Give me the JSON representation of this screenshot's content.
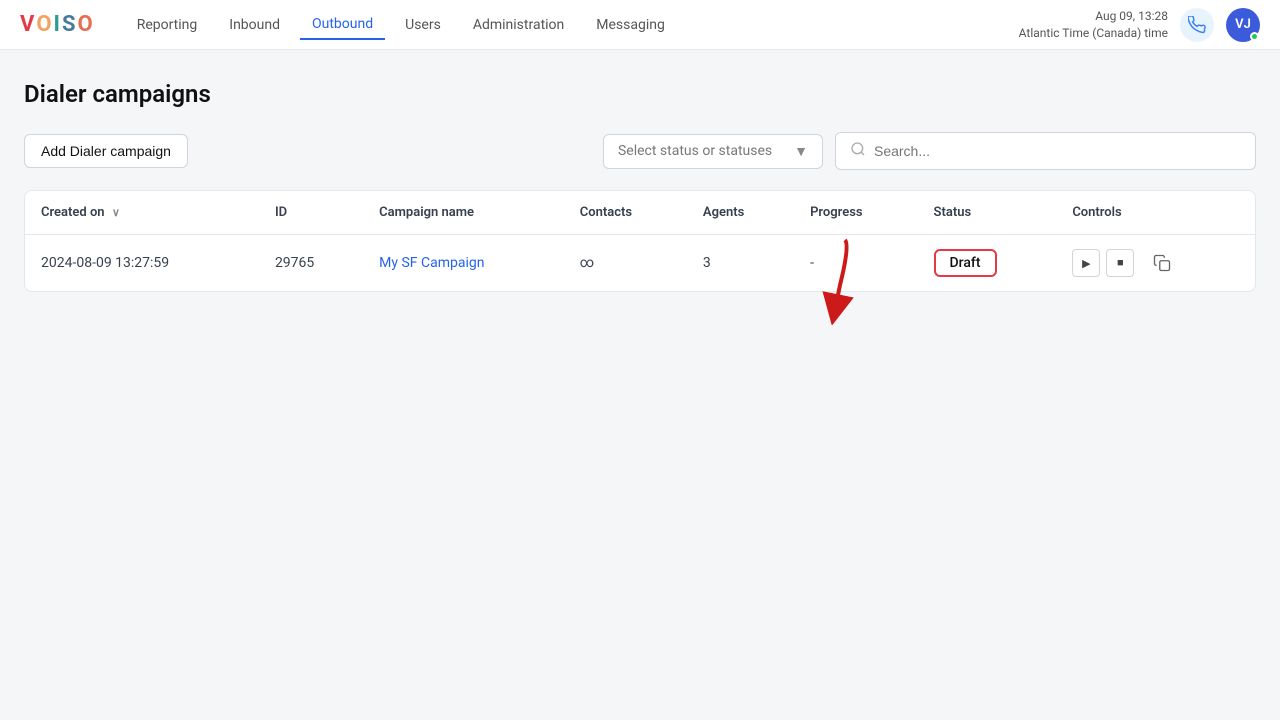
{
  "logo": {
    "text": "VOISO",
    "parts": [
      "V",
      "O",
      "I",
      "S",
      "O"
    ]
  },
  "nav": {
    "items": [
      {
        "label": "Reporting",
        "active": false
      },
      {
        "label": "Inbound",
        "active": false
      },
      {
        "label": "Outbound",
        "active": true
      },
      {
        "label": "Users",
        "active": false
      },
      {
        "label": "Administration",
        "active": false
      },
      {
        "label": "Messaging",
        "active": false
      }
    ]
  },
  "header": {
    "datetime_line1": "Aug 09, 13:28",
    "datetime_line2": "Atlantic Time (Canada) time",
    "avatar_initials": "VJ"
  },
  "page": {
    "title": "Dialer campaigns",
    "add_button": "Add Dialer campaign",
    "status_placeholder": "Select status or statuses",
    "search_placeholder": "Search..."
  },
  "table": {
    "columns": [
      {
        "label": "Created on",
        "sortable": true
      },
      {
        "label": "ID",
        "sortable": false
      },
      {
        "label": "Campaign name",
        "sortable": false
      },
      {
        "label": "Contacts",
        "sortable": false
      },
      {
        "label": "Agents",
        "sortable": false
      },
      {
        "label": "Progress",
        "sortable": false
      },
      {
        "label": "Status",
        "sortable": false
      },
      {
        "label": "Controls",
        "sortable": false
      }
    ],
    "rows": [
      {
        "created_on": "2024-08-09  13:27:59",
        "id": "29765",
        "campaign_name": "My SF Campaign",
        "contacts": "∞",
        "agents": "3",
        "progress": "-",
        "status": "Draft"
      }
    ]
  }
}
